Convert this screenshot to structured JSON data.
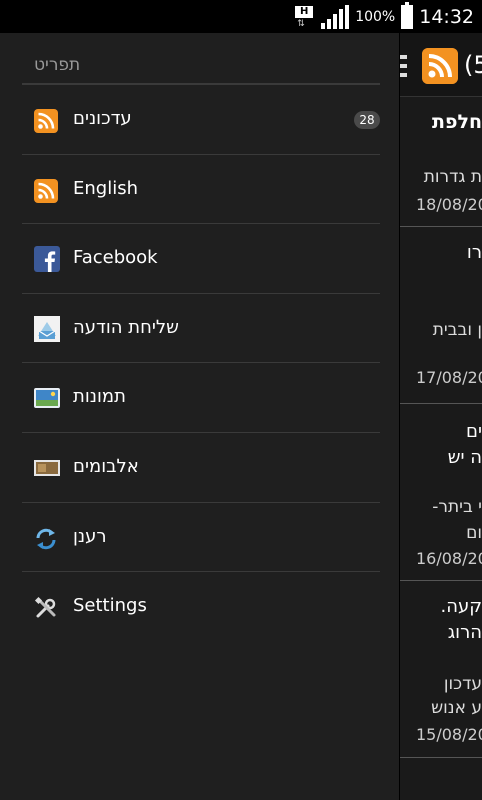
{
  "status_bar": {
    "network": "H",
    "battery_percent": "100%",
    "time": "14:32"
  },
  "main": {
    "title": "(5",
    "tab": "חלפת",
    "items": [
      {
        "title": "ת גדרות",
        "subtitle": "",
        "date": "18/08/20"
      },
      {
        "title": "רו",
        "subtitle": "ן ובבית",
        "date": "17/08/20"
      },
      {
        "title": "ים",
        "title2": "ה יש",
        "subtitle": "י ביתר-",
        "subtitle2": "ום",
        "date": "16/08/20"
      },
      {
        "title": "קעה.",
        "title2": "הרוג",
        "subtitle": "עדכון",
        "subtitle2": "ע אנוש",
        "date": "15/08/20"
      }
    ]
  },
  "drawer": {
    "header": "תפריט",
    "items": [
      {
        "label": "עדכונים",
        "icon": "rss-icon",
        "badge": "28"
      },
      {
        "label": "English",
        "icon": "rss-icon"
      },
      {
        "label": "Facebook",
        "icon": "facebook-icon"
      },
      {
        "label": "שליחת הודעה",
        "icon": "send-message-icon"
      },
      {
        "label": "תמונות",
        "icon": "gallery-icon"
      },
      {
        "label": "אלבומים",
        "icon": "album-icon"
      },
      {
        "label": "רענן",
        "icon": "refresh-icon"
      },
      {
        "label": "Settings",
        "icon": "settings-icon"
      }
    ]
  },
  "colors": {
    "rss_orange": "#f39221",
    "facebook_blue": "#3b5998",
    "drawer_bg": "#1f1f1f"
  }
}
